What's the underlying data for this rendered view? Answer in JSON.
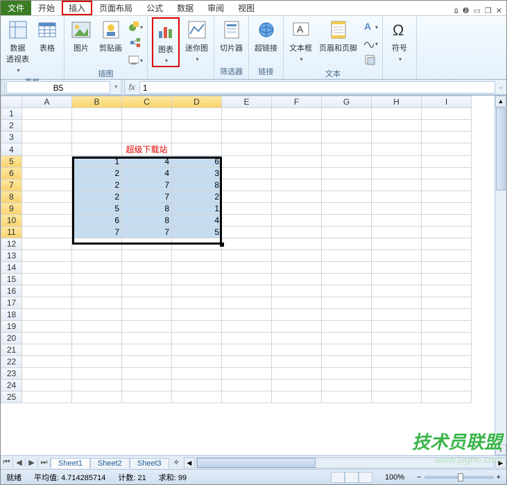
{
  "tabs": {
    "file": "文件",
    "home": "开始",
    "insert": "插入",
    "layout": "页面布局",
    "formulas": "公式",
    "data": "数据",
    "review": "审阅",
    "view": "视图"
  },
  "ribbon": {
    "g_table": "表格",
    "g_illust": "插图",
    "g_filter": "筛选器",
    "g_link": "链接",
    "g_text": "文本",
    "pivot": "数据\n透视表",
    "table": "表格",
    "picture": "图片",
    "clipart": "剪贴画",
    "chart": "图表",
    "sparkline": "迷你图",
    "slicer": "切片器",
    "hyperlink": "超链接",
    "textbox": "文本框",
    "headerfooter": "页眉和页脚",
    "symbol": "符号"
  },
  "namebox": "B5",
  "formula": "1",
  "columns": [
    "A",
    "B",
    "C",
    "D",
    "E",
    "F",
    "G",
    "H",
    "I"
  ],
  "title_text": "超级下载站",
  "data_rows": [
    [
      "1",
      "4",
      "6"
    ],
    [
      "2",
      "4",
      "3"
    ],
    [
      "2",
      "7",
      "8"
    ],
    [
      "2",
      "7",
      "2"
    ],
    [
      "5",
      "8",
      "1"
    ],
    [
      "6",
      "8",
      "4"
    ],
    [
      "7",
      "7",
      "5"
    ]
  ],
  "sheets": {
    "s1": "Sheet1",
    "s2": "Sheet2",
    "s3": "Sheet3"
  },
  "status": {
    "ready": "就绪",
    "avg_label": "平均值:",
    "avg_val": "4.714285714",
    "count_label": "计数:",
    "count_val": "21",
    "sum_label": "求和:",
    "sum_val": "99",
    "zoom": "100%"
  },
  "watermark": {
    "big": "技术员联盟",
    "small": "www.jsgho.com"
  }
}
